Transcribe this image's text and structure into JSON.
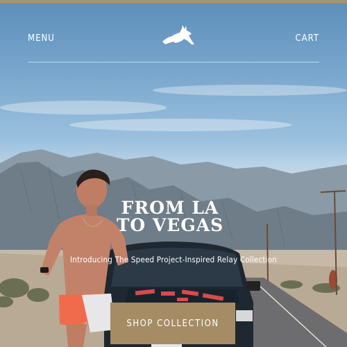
{
  "header": {
    "menu_label": "MENU",
    "cart_label": "CART",
    "logo_icon": "jackrabbit-logo-icon"
  },
  "hero": {
    "title_line1": "FROM LA",
    "title_line2": "TO VEGAS",
    "subtitle": "Introducing The Speed Project-Inspired Relay Collection",
    "cta_label": "SHOP COLLECTION"
  },
  "colors": {
    "top_strip": "#a6936a",
    "cta_background": "#a58c64",
    "text": "#ffffff"
  }
}
